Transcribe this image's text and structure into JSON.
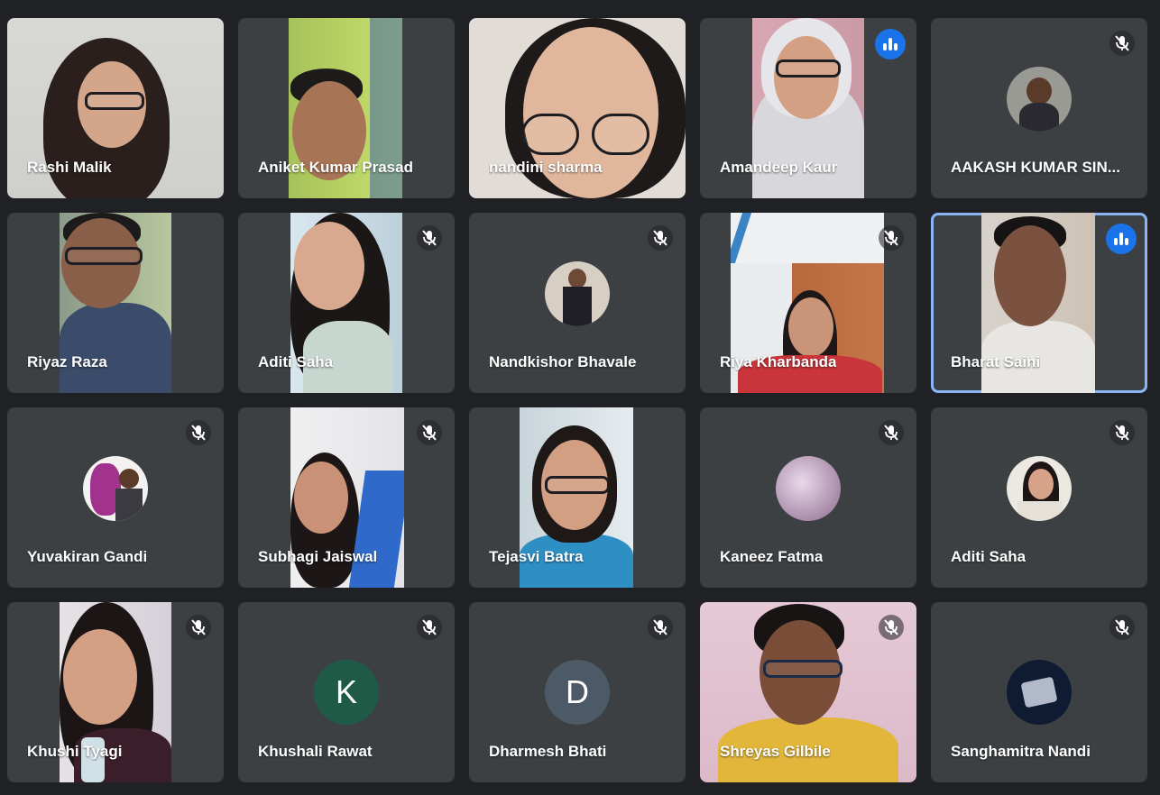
{
  "participants": [
    {
      "name": "Rashi Malik",
      "state": "video",
      "speaking": false,
      "muted": false
    },
    {
      "name": "Aniket Kumar Prasad",
      "state": "video",
      "speaking": false,
      "muted": false
    },
    {
      "name": "nandini sharma",
      "state": "video",
      "speaking": false,
      "muted": false
    },
    {
      "name": "Amandeep Kaur",
      "state": "video",
      "speaking": true,
      "muted": false
    },
    {
      "name": "AAKASH KUMAR SIN...",
      "state": "avatar",
      "speaking": false,
      "muted": true
    },
    {
      "name": "Riyaz Raza",
      "state": "video",
      "speaking": false,
      "muted": false
    },
    {
      "name": "Aditi Saha",
      "state": "video",
      "speaking": false,
      "muted": true
    },
    {
      "name": "Nandkishor Bhavale",
      "state": "avatar",
      "speaking": false,
      "muted": true
    },
    {
      "name": "Riya Kharbanda",
      "state": "video",
      "speaking": false,
      "muted": true
    },
    {
      "name": "Bharat Saini",
      "state": "video",
      "speaking": true,
      "muted": false,
      "active": true
    },
    {
      "name": "Yuvakiran Gandi",
      "state": "avatar",
      "speaking": false,
      "muted": true
    },
    {
      "name": "Subhagi Jaiswal",
      "state": "video",
      "speaking": false,
      "muted": true
    },
    {
      "name": "Tejasvi Batra",
      "state": "video",
      "speaking": false,
      "muted": false
    },
    {
      "name": "Kaneez Fatma",
      "state": "avatar",
      "speaking": false,
      "muted": true
    },
    {
      "name": "Aditi Saha",
      "state": "avatar",
      "speaking": false,
      "muted": true
    },
    {
      "name": "Khushi Tyagi",
      "state": "video",
      "speaking": false,
      "muted": true
    },
    {
      "name": "Khushali Rawat",
      "state": "letter",
      "letter": "K",
      "avatar_color": "#1e5a45",
      "speaking": false,
      "muted": true
    },
    {
      "name": "Dharmesh Bhati",
      "state": "letter",
      "letter": "D",
      "avatar_color": "#4b5a66",
      "speaking": false,
      "muted": true
    },
    {
      "name": "Shreyas Gilbile",
      "state": "video",
      "speaking": false,
      "muted": true
    },
    {
      "name": "Sanghamitra Nandi",
      "state": "avatar",
      "speaking": false,
      "muted": true
    }
  ],
  "icons": {
    "muted": "mic-off-icon",
    "speaking": "audio-level-icon"
  },
  "colors": {
    "background": "#202124",
    "tile": "#3c4043",
    "active_outline": "#8ab4f8",
    "speaking_badge": "#1a73e8"
  }
}
